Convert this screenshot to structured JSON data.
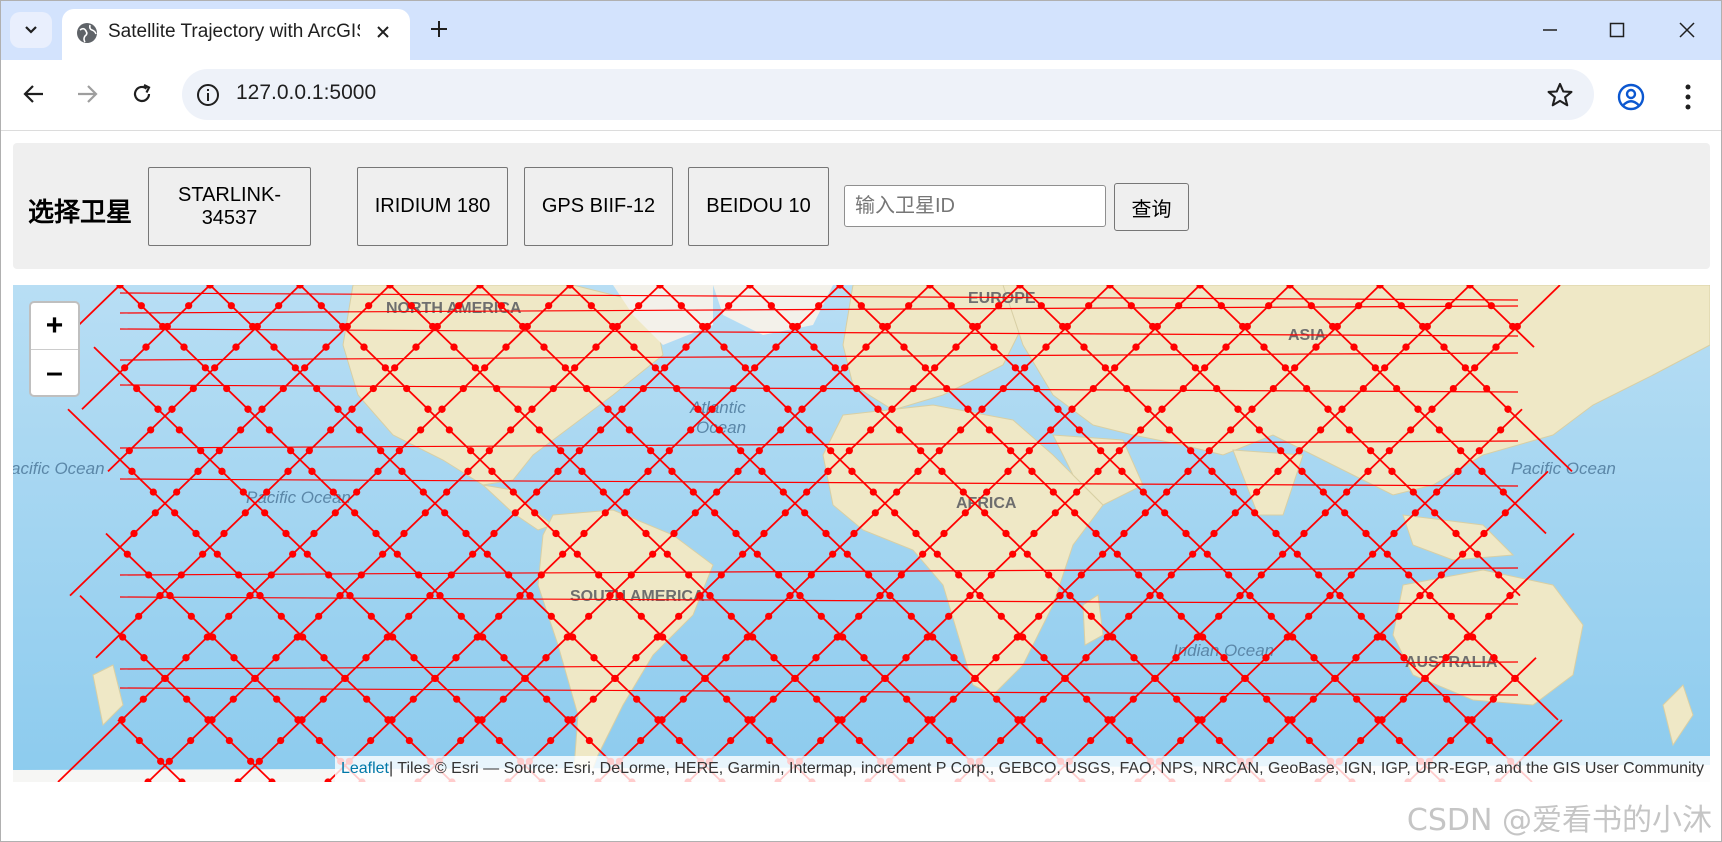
{
  "browser": {
    "tab_title": "Satellite Trajectory with ArcGIS",
    "new_tab_symbol": "+",
    "url": "127.0.0.1:5000",
    "icons": [
      "tab-search-icon",
      "globe-favicon-icon",
      "close-icon",
      "plus-icon",
      "minimize-icon",
      "maximize-icon",
      "close-window-icon",
      "back-icon",
      "forward-icon",
      "reload-icon",
      "site-info-icon",
      "bookmark-star-icon",
      "profile-icon",
      "more-menu-icon"
    ]
  },
  "panel": {
    "title": "选择卫星",
    "satellites": [
      "STARLINK-34537",
      "IRIDIUM 180",
      "GPS BIIF-12",
      "BEIDOU 10"
    ],
    "input_placeholder": "输入卫星ID",
    "query_label": "查询"
  },
  "map": {
    "zoom_in": "+",
    "zoom_out": "–",
    "labels": {
      "north_america": "NORTH AMERICA",
      "europe": "EUROPE",
      "asia": "ASIA",
      "atlantic": "Atlantic",
      "ocean": "Ocean",
      "pacific_left": "acific Ocean",
      "pacific_mid": "Pacific Ocean",
      "pacific_right": "Pacific Ocean",
      "africa": "AFRICA",
      "south_america": "SOUTH AMERICA",
      "indian_ocean": "Indian Ocean",
      "australia": "AUSTRALIA"
    },
    "attribution_link": "Leaflet",
    "attribution_text": " | Tiles © Esri — Source: Esri, DeLorme, HERE, Garmin, Intermap, increment P Corp., GEBCO, USGS, FAO, NPS, NRCAN, GeoBase, IGN, IGP, UPR-EGP, and the GIS User Community",
    "track_color": "#ff0000"
  },
  "watermark": "CSDN @爱看书的小沐"
}
